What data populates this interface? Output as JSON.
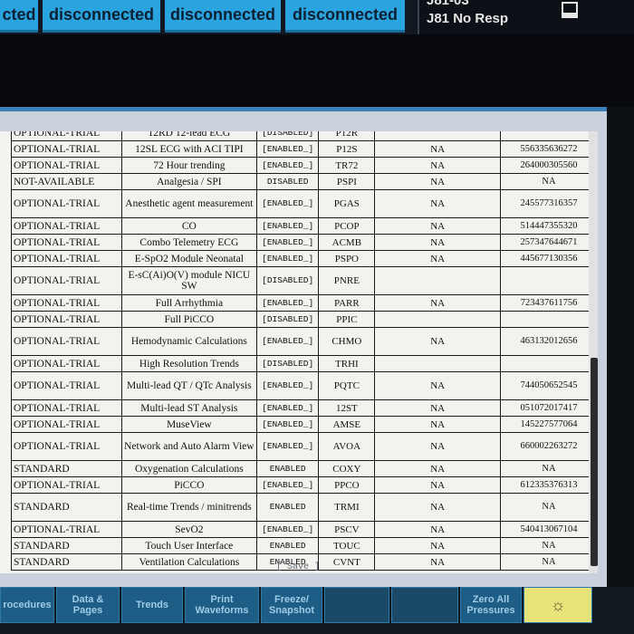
{
  "topbar": {
    "buttons": [
      "cted",
      "disconnected",
      "disconnected",
      "disconnected"
    ],
    "alarm": {
      "line1": "J81-03",
      "line2": "J81 No Resp"
    }
  },
  "rows": [
    {
      "lic": "OPTIONAL-TRIAL",
      "name": "12RD 12-lead ECG",
      "status": "[DISABLED]",
      "code": "P12R",
      "na": "",
      "key": ""
    },
    {
      "lic": "OPTIONAL-TRIAL",
      "name": "12SL ECG with ACI TIPI",
      "status": "[ENABLED_]",
      "code": "P12S",
      "na": "NA",
      "key": "556335636272"
    },
    {
      "lic": "OPTIONAL-TRIAL",
      "name": "72 Hour trending",
      "status": "[ENABLED_]",
      "code": "TR72",
      "na": "NA",
      "key": "264000305560"
    },
    {
      "lic": "NOT-AVAILABLE",
      "name": "Analgesia / SPI",
      "status": "DISABLED",
      "code": "PSPI",
      "na": "NA",
      "key": "NA"
    },
    {
      "lic": "OPTIONAL-TRIAL",
      "name": "Anesthetic agent measurement",
      "status": "[ENABLED_]",
      "code": "PGAS",
      "na": "NA",
      "key": "245577316357"
    },
    {
      "lic": "OPTIONAL-TRIAL",
      "name": "CO",
      "status": "[ENABLED_]",
      "code": "PCOP",
      "na": "NA",
      "key": "514447355320"
    },
    {
      "lic": "OPTIONAL-TRIAL",
      "name": "Combo Telemetry ECG",
      "status": "[ENABLED_]",
      "code": "ACMB",
      "na": "NA",
      "key": "257347644671"
    },
    {
      "lic": "OPTIONAL-TRIAL",
      "name": "E-SpO2 Module Neonatal",
      "status": "[ENABLED_]",
      "code": "PSPO",
      "na": "NA",
      "key": "445677130356"
    },
    {
      "lic": "OPTIONAL-TRIAL",
      "name": "E-sC(Ai)O(V) module NICU SW",
      "status": "[DISABLED]",
      "code": "PNRE",
      "na": "",
      "key": ""
    },
    {
      "lic": "OPTIONAL-TRIAL",
      "name": "Full Arrhythmia",
      "status": "[ENABLED_]",
      "code": "PARR",
      "na": "NA",
      "key": "723437611756"
    },
    {
      "lic": "OPTIONAL-TRIAL",
      "name": "Full PiCCO",
      "status": "[DISABLED]",
      "code": "PPIC",
      "na": "",
      "key": ""
    },
    {
      "lic": "OPTIONAL-TRIAL",
      "name": "Hemodynamic Calculations",
      "status": "[ENABLED_]",
      "code": "CHMO",
      "na": "NA",
      "key": "463132012656"
    },
    {
      "lic": "OPTIONAL-TRIAL",
      "name": "High Resolution Trends",
      "status": "[DISABLED]",
      "code": "TRHI",
      "na": "",
      "key": ""
    },
    {
      "lic": "OPTIONAL-TRIAL",
      "name": "Multi-lead QT / QTc Analysis",
      "status": "[ENABLED_]",
      "code": "PQTC",
      "na": "NA",
      "key": "744050652545"
    },
    {
      "lic": "OPTIONAL-TRIAL",
      "name": "Multi-lead ST Analysis",
      "status": "[ENABLED_]",
      "code": "12ST",
      "na": "NA",
      "key": "051072017417"
    },
    {
      "lic": "OPTIONAL-TRIAL",
      "name": "MuseView",
      "status": "[ENABLED_]",
      "code": "AMSE",
      "na": "NA",
      "key": "145227577064"
    },
    {
      "lic": "OPTIONAL-TRIAL",
      "name": "Network and Auto Alarm View",
      "status": "[ENABLED_]",
      "code": "AVOA",
      "na": "NA",
      "key": "660002263272"
    },
    {
      "lic": "STANDARD",
      "name": "Oxygenation Calculations",
      "status": "ENABLED",
      "code": "COXY",
      "na": "NA",
      "key": "NA"
    },
    {
      "lic": "OPTIONAL-TRIAL",
      "name": "PiCCO",
      "status": "[ENABLED_]",
      "code": "PPCO",
      "na": "NA",
      "key": "612335376313"
    },
    {
      "lic": "STANDARD",
      "name": "Real-time Trends / minitrends",
      "status": "ENABLED",
      "code": "TRMI",
      "na": "NA",
      "key": "NA"
    },
    {
      "lic": "OPTIONAL-TRIAL",
      "name": "SevO2",
      "status": "[ENABLED_]",
      "code": "PSCV",
      "na": "NA",
      "key": "540413067104"
    },
    {
      "lic": "STANDARD",
      "name": "Touch User Interface",
      "status": "ENABLED",
      "code": "TOUC",
      "na": "NA",
      "key": "NA"
    },
    {
      "lic": "STANDARD",
      "name": "Ventilation Calculations",
      "status": "ENABLED",
      "code": "CVNT",
      "na": "NA",
      "key": "NA"
    }
  ],
  "save_label": "[ Save ]",
  "left_edge": "nt",
  "bottom": {
    "b0": "rocedures",
    "b1": "Data & Pages",
    "b2": "Trends",
    "b3": "Print Waveforms",
    "b4": "Freeze/ Snapshot",
    "b5": "",
    "b6": "",
    "b7": "Zero All Pressures"
  }
}
